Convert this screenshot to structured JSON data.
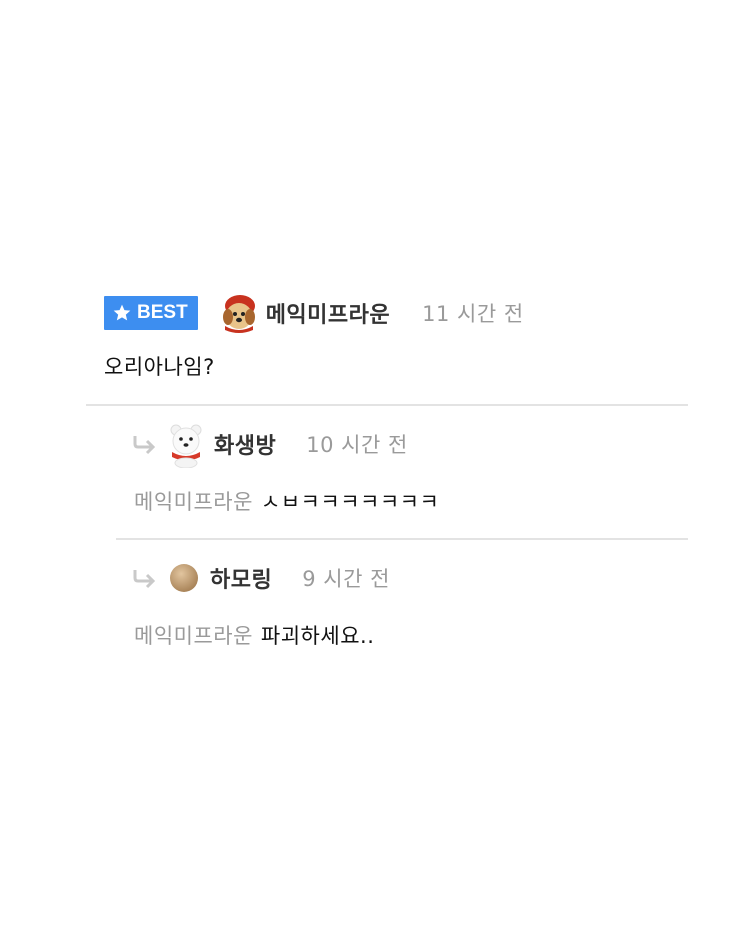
{
  "comment": {
    "badge_label": "BEST",
    "username": "메익미프라운",
    "time": "11 시간 전",
    "text": "오리아나임?"
  },
  "replies": [
    {
      "username": "화생방",
      "time": "10 시간 전",
      "mention": "메익미프라운",
      "text": "ㅅㅂㅋㅋㅋㅋㅋㅋㅋ"
    },
    {
      "username": "하모링",
      "time": "9 시간 전",
      "mention": "메익미프라운",
      "text": "파괴하세요.."
    }
  ],
  "colors": {
    "best_badge": "#3d8ef0",
    "muted_text": "#9a9a9a",
    "divider": "#e3e3e3"
  },
  "icons": [
    "star-icon",
    "puppy-avatar-icon",
    "reply-arrow-icon",
    "polar-bear-avatar-icon",
    "brown-circle-avatar-icon"
  ]
}
